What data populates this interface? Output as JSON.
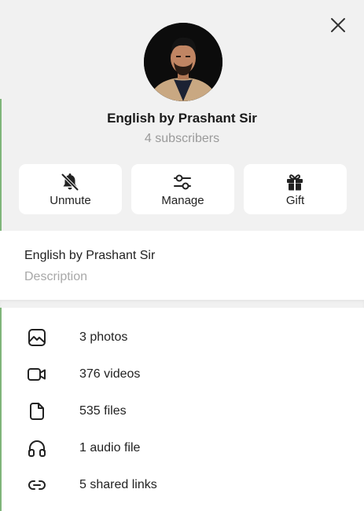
{
  "channel": {
    "name": "English by Prashant Sir",
    "subscribers": "4 subscribers"
  },
  "close_icon": "close-icon",
  "actions": [
    {
      "label": "Unmute",
      "icon": "bell-off-icon"
    },
    {
      "label": "Manage",
      "icon": "sliders-icon"
    },
    {
      "label": "Gift",
      "icon": "gift-icon"
    }
  ],
  "info": {
    "name": "English by Prashant Sir",
    "description_placeholder": "Description"
  },
  "media": [
    {
      "label": "3 photos",
      "icon": "photo-icon"
    },
    {
      "label": "376 videos",
      "icon": "video-icon"
    },
    {
      "label": "535 files",
      "icon": "file-icon"
    },
    {
      "label": "1 audio file",
      "icon": "headphones-icon"
    },
    {
      "label": "5 shared links",
      "icon": "link-icon"
    }
  ],
  "colors": {
    "header_bg": "#f1f1f1",
    "muted_text": "#9a9a9a",
    "left_accent": "#7fb57a"
  }
}
